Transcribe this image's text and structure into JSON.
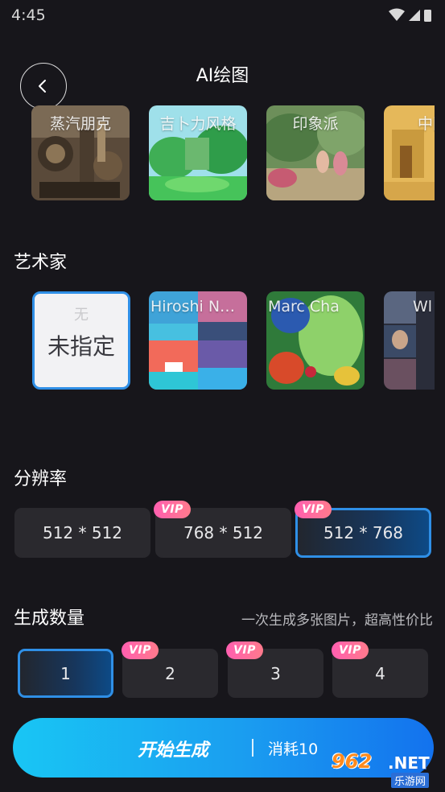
{
  "status_bar": {
    "time": "4:45"
  },
  "header": {
    "title": "AI绘图"
  },
  "styles": [
    {
      "label": "蒸汽朋克"
    },
    {
      "label": "吉卜力风格"
    },
    {
      "label": "印象派"
    },
    {
      "label": "中国"
    }
  ],
  "artist_section": {
    "title": "艺术家",
    "none_small": "无",
    "none_big": "未指定",
    "artists": [
      {
        "label": "Hiroshi N…"
      },
      {
        "label": "Marc Cha"
      },
      {
        "label": "Wl"
      }
    ]
  },
  "resolution_section": {
    "title": "分辨率",
    "options": [
      {
        "label": "512 * 512",
        "vip": false,
        "selected": false
      },
      {
        "label": "768 * 512",
        "vip": true,
        "selected": false
      },
      {
        "label": "512 * 768",
        "vip": true,
        "selected": true
      }
    ]
  },
  "quantity_section": {
    "title": "生成数量",
    "hint": "一次生成多张图片，超高性价比",
    "options": [
      {
        "label": "1",
        "vip": false,
        "selected": true
      },
      {
        "label": "2",
        "vip": true,
        "selected": false
      },
      {
        "label": "3",
        "vip": true,
        "selected": false
      },
      {
        "label": "4",
        "vip": true,
        "selected": false
      }
    ]
  },
  "vip_badge": "VIP",
  "start_button": {
    "label": "开始生成",
    "cost": "消耗10"
  },
  "watermark": {
    "logo": "962",
    "net": ".NET",
    "sub": "乐游网"
  },
  "colors": {
    "accent": "#2f8fe6",
    "vip": "#ff5fb0",
    "background": "#17161b"
  }
}
